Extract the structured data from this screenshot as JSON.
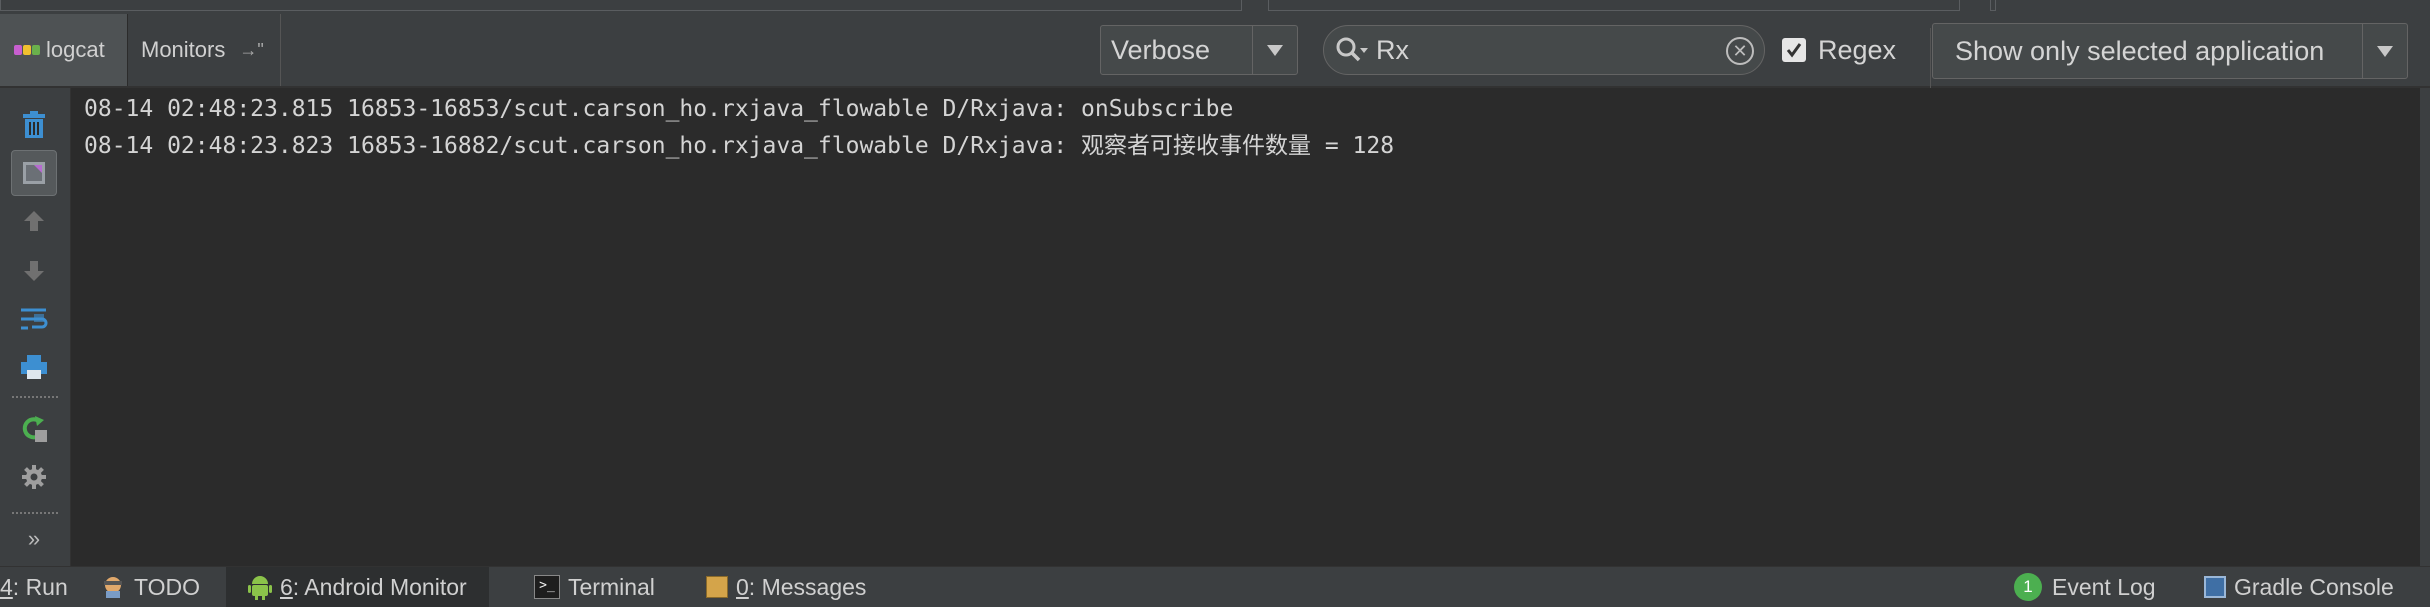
{
  "tabs": {
    "logcat": "logcat",
    "monitors": "Monitors",
    "monitors_suffix": "→\""
  },
  "filters": {
    "level": "Verbose",
    "search_value": "Rx",
    "regex_label": "Regex",
    "regex_checked": true,
    "app_filter": "Show only selected application"
  },
  "left_toolbar": {
    "icons": [
      "trash-icon",
      "scroll-to-end-icon",
      "up-arrow-icon",
      "down-arrow-icon",
      "soft-wrap-icon",
      "print-icon",
      "restart-icon",
      "gear-icon",
      "more-icon"
    ]
  },
  "log": {
    "lines": [
      "08-14 02:48:23.815 16853-16853/scut.carson_ho.rxjava_flowable D/Rxjava: onSubscribe",
      "08-14 02:48:23.823 16853-16882/scut.carson_ho.rxjava_flowable D/Rxjava: 观察者可接收事件数量 = 128"
    ]
  },
  "statusbar": {
    "run_num": "4",
    "run_label": ": Run",
    "todo": "TODO",
    "android_num": "6",
    "android_label": ": Android Monitor",
    "terminal": "Terminal",
    "messages_num": "0",
    "messages_label": ": Messages",
    "event_count": "1",
    "event_log": "Event Log",
    "gradle_console": "Gradle Console"
  },
  "colors": {
    "background": "#2b2b2b",
    "panel": "#3c3f41",
    "accent_green": "#4caf50",
    "trash_blue": "#3d8fd1"
  }
}
